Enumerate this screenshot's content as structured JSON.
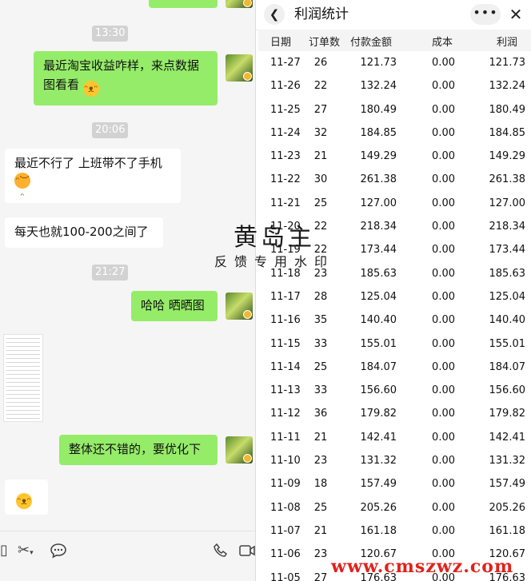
{
  "chat": {
    "times": [
      "13:30",
      "20:06",
      "21:27"
    ],
    "messages": [
      {
        "from": "me",
        "text": "最近淘宝收益咋样，来点数据图看看"
      },
      {
        "from": "other",
        "text": "最近不行了 上班带不了手机"
      },
      {
        "from": "other",
        "text": "每天也就100-200之间了"
      },
      {
        "from": "me",
        "text": "哈哈 晒晒图"
      },
      {
        "from": "me",
        "text": "整体还不错的，要优化下"
      }
    ]
  },
  "icons": {
    "avatar": "avatar-icon",
    "emoji_grin": "grin-emoji-icon",
    "emoji_laugh_cry": "laugh-cry-emoji-icon",
    "scissors": "scissors-icon",
    "chat": "chat-bubble-icon",
    "phone": "phone-icon",
    "video": "video-icon",
    "back": "chevron-left-icon",
    "more": "more-dots-icon",
    "close": "close-icon"
  },
  "panel": {
    "title": "利润统计",
    "headers": [
      "日期",
      "订单数",
      "付款金额",
      "成本",
      "利润"
    ],
    "rows": [
      [
        "11-27",
        "26",
        "121.73",
        "0.00",
        "121.73"
      ],
      [
        "11-26",
        "22",
        "132.24",
        "0.00",
        "132.24"
      ],
      [
        "11-25",
        "27",
        "180.49",
        "0.00",
        "180.49"
      ],
      [
        "11-24",
        "32",
        "184.85",
        "0.00",
        "184.85"
      ],
      [
        "11-23",
        "21",
        "149.29",
        "0.00",
        "149.29"
      ],
      [
        "11-22",
        "30",
        "261.38",
        "0.00",
        "261.38"
      ],
      [
        "11-21",
        "25",
        "127.00",
        "0.00",
        "127.00"
      ],
      [
        "11-20",
        "22",
        "218.34",
        "0.00",
        "218.34"
      ],
      [
        "11-19",
        "22",
        "173.44",
        "0.00",
        "173.44"
      ],
      [
        "11-18",
        "23",
        "185.63",
        "0.00",
        "185.63"
      ],
      [
        "11-17",
        "28",
        "125.04",
        "0.00",
        "125.04"
      ],
      [
        "11-16",
        "35",
        "140.40",
        "0.00",
        "140.40"
      ],
      [
        "11-15",
        "33",
        "155.01",
        "0.00",
        "155.01"
      ],
      [
        "11-14",
        "25",
        "184.07",
        "0.00",
        "184.07"
      ],
      [
        "11-13",
        "33",
        "156.60",
        "0.00",
        "156.60"
      ],
      [
        "11-12",
        "36",
        "179.82",
        "0.00",
        "179.82"
      ],
      [
        "11-11",
        "21",
        "142.41",
        "0.00",
        "142.41"
      ],
      [
        "11-10",
        "23",
        "131.32",
        "0.00",
        "131.32"
      ],
      [
        "11-09",
        "18",
        "157.49",
        "0.00",
        "157.49"
      ],
      [
        "11-08",
        "25",
        "205.26",
        "0.00",
        "205.26"
      ],
      [
        "11-07",
        "21",
        "161.18",
        "0.00",
        "161.18"
      ],
      [
        "11-06",
        "23",
        "120.67",
        "0.00",
        "120.67"
      ],
      [
        "11-05",
        "27",
        "176.63",
        "0.00",
        "176.63"
      ]
    ]
  },
  "watermark": {
    "main": "黄岛主",
    "sub": "反馈专用水印",
    "site": "www.cmszwz.com"
  },
  "colors": {
    "me_bubble": "#95ec69",
    "other_bubble": "#ffffff",
    "site_red": "#e0231c"
  }
}
